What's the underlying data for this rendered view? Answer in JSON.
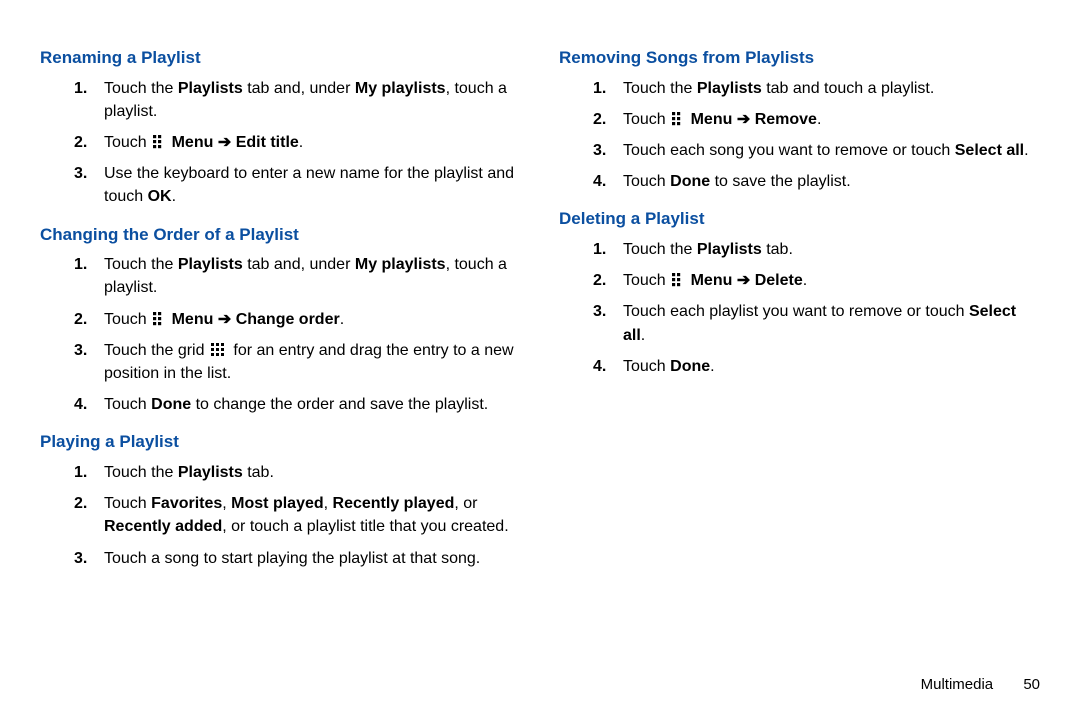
{
  "footer": {
    "section": "Multimedia",
    "page": "50"
  },
  "arrow": "➔",
  "left": {
    "sections": [
      {
        "heading": "Renaming a Playlist",
        "steps": [
          {
            "type": "rich",
            "parts": [
              {
                "t": "Touch the "
              },
              {
                "t": "Playlists",
                "b": true
              },
              {
                "t": " tab and, under "
              },
              {
                "t": "My playlists",
                "b": true
              },
              {
                "t": ", touch a playlist."
              }
            ]
          },
          {
            "type": "menu3",
            "before": "Touch ",
            "after_parts": [
              {
                "t": " "
              },
              {
                "t": "Menu",
                "b": true
              },
              {
                "t": " "
              },
              {
                "arrow": true
              },
              {
                "t": " "
              },
              {
                "t": "Edit title",
                "b": true
              },
              {
                "t": "."
              }
            ]
          },
          {
            "type": "rich",
            "parts": [
              {
                "t": "Use the keyboard to enter a new name for the playlist and touch "
              },
              {
                "t": "OK",
                "b": true
              },
              {
                "t": "."
              }
            ]
          }
        ]
      },
      {
        "heading": "Changing the Order of a Playlist",
        "steps": [
          {
            "type": "rich",
            "parts": [
              {
                "t": "Touch the "
              },
              {
                "t": "Playlists",
                "b": true
              },
              {
                "t": " tab and, under "
              },
              {
                "t": "My playlists",
                "b": true
              },
              {
                "t": ", touch a playlist."
              }
            ]
          },
          {
            "type": "menu3",
            "before": "Touch ",
            "after_parts": [
              {
                "t": " "
              },
              {
                "t": "Menu",
                "b": true
              },
              {
                "t": " "
              },
              {
                "arrow": true
              },
              {
                "t": " "
              },
              {
                "t": "Change order",
                "b": true
              },
              {
                "t": "."
              }
            ]
          },
          {
            "type": "grid9",
            "before": "Touch the grid ",
            "after": " for an entry and drag the entry to a new position in the list."
          },
          {
            "type": "rich",
            "parts": [
              {
                "t": "Touch "
              },
              {
                "t": "Done",
                "b": true
              },
              {
                "t": " to change the order and save the playlist."
              }
            ]
          }
        ]
      },
      {
        "heading": "Playing a Playlist",
        "steps": [
          {
            "type": "rich",
            "parts": [
              {
                "t": "Touch the "
              },
              {
                "t": "Playlists",
                "b": true
              },
              {
                "t": " tab."
              }
            ]
          },
          {
            "type": "rich",
            "parts": [
              {
                "t": "Touch "
              },
              {
                "t": "Favorites",
                "b": true
              },
              {
                "t": ", "
              },
              {
                "t": "Most played",
                "b": true
              },
              {
                "t": ", "
              },
              {
                "t": "Recently played",
                "b": true
              },
              {
                "t": ", or "
              },
              {
                "t": "Recently added",
                "b": true
              },
              {
                "t": ", or touch a playlist title that you created."
              }
            ]
          },
          {
            "type": "rich",
            "parts": [
              {
                "t": "Touch a song to start playing the playlist at that song."
              }
            ]
          }
        ]
      }
    ]
  },
  "right": {
    "sections": [
      {
        "heading": "Removing Songs from Playlists",
        "steps": [
          {
            "type": "rich",
            "parts": [
              {
                "t": "Touch the "
              },
              {
                "t": "Playlists",
                "b": true
              },
              {
                "t": " tab and touch a playlist."
              }
            ]
          },
          {
            "type": "menu3",
            "before": "Touch ",
            "after_parts": [
              {
                "t": " "
              },
              {
                "t": "Menu",
                "b": true
              },
              {
                "t": " "
              },
              {
                "arrow": true
              },
              {
                "t": " "
              },
              {
                "t": "Remove",
                "b": true
              },
              {
                "t": "."
              }
            ]
          },
          {
            "type": "rich",
            "parts": [
              {
                "t": "Touch each song you want to remove or touch "
              },
              {
                "t": "Select all",
                "b": true
              },
              {
                "t": "."
              }
            ]
          },
          {
            "type": "rich",
            "parts": [
              {
                "t": "Touch "
              },
              {
                "t": "Done",
                "b": true
              },
              {
                "t": " to save the playlist."
              }
            ]
          }
        ]
      },
      {
        "heading": "Deleting a Playlist",
        "steps": [
          {
            "type": "rich",
            "parts": [
              {
                "t": "Touch the "
              },
              {
                "t": "Playlists",
                "b": true
              },
              {
                "t": " tab."
              }
            ]
          },
          {
            "type": "menu3",
            "before": "Touch ",
            "after_parts": [
              {
                "t": " "
              },
              {
                "t": "Menu",
                "b": true
              },
              {
                "t": " "
              },
              {
                "arrow": true
              },
              {
                "t": " "
              },
              {
                "t": "Delete",
                "b": true
              },
              {
                "t": "."
              }
            ]
          },
          {
            "type": "rich",
            "parts": [
              {
                "t": "Touch each playlist you want to remove or touch "
              },
              {
                "t": "Select all",
                "b": true
              },
              {
                "t": "."
              }
            ]
          },
          {
            "type": "rich",
            "parts": [
              {
                "t": "Touch "
              },
              {
                "t": "Done",
                "b": true
              },
              {
                "t": "."
              }
            ]
          }
        ]
      }
    ]
  }
}
